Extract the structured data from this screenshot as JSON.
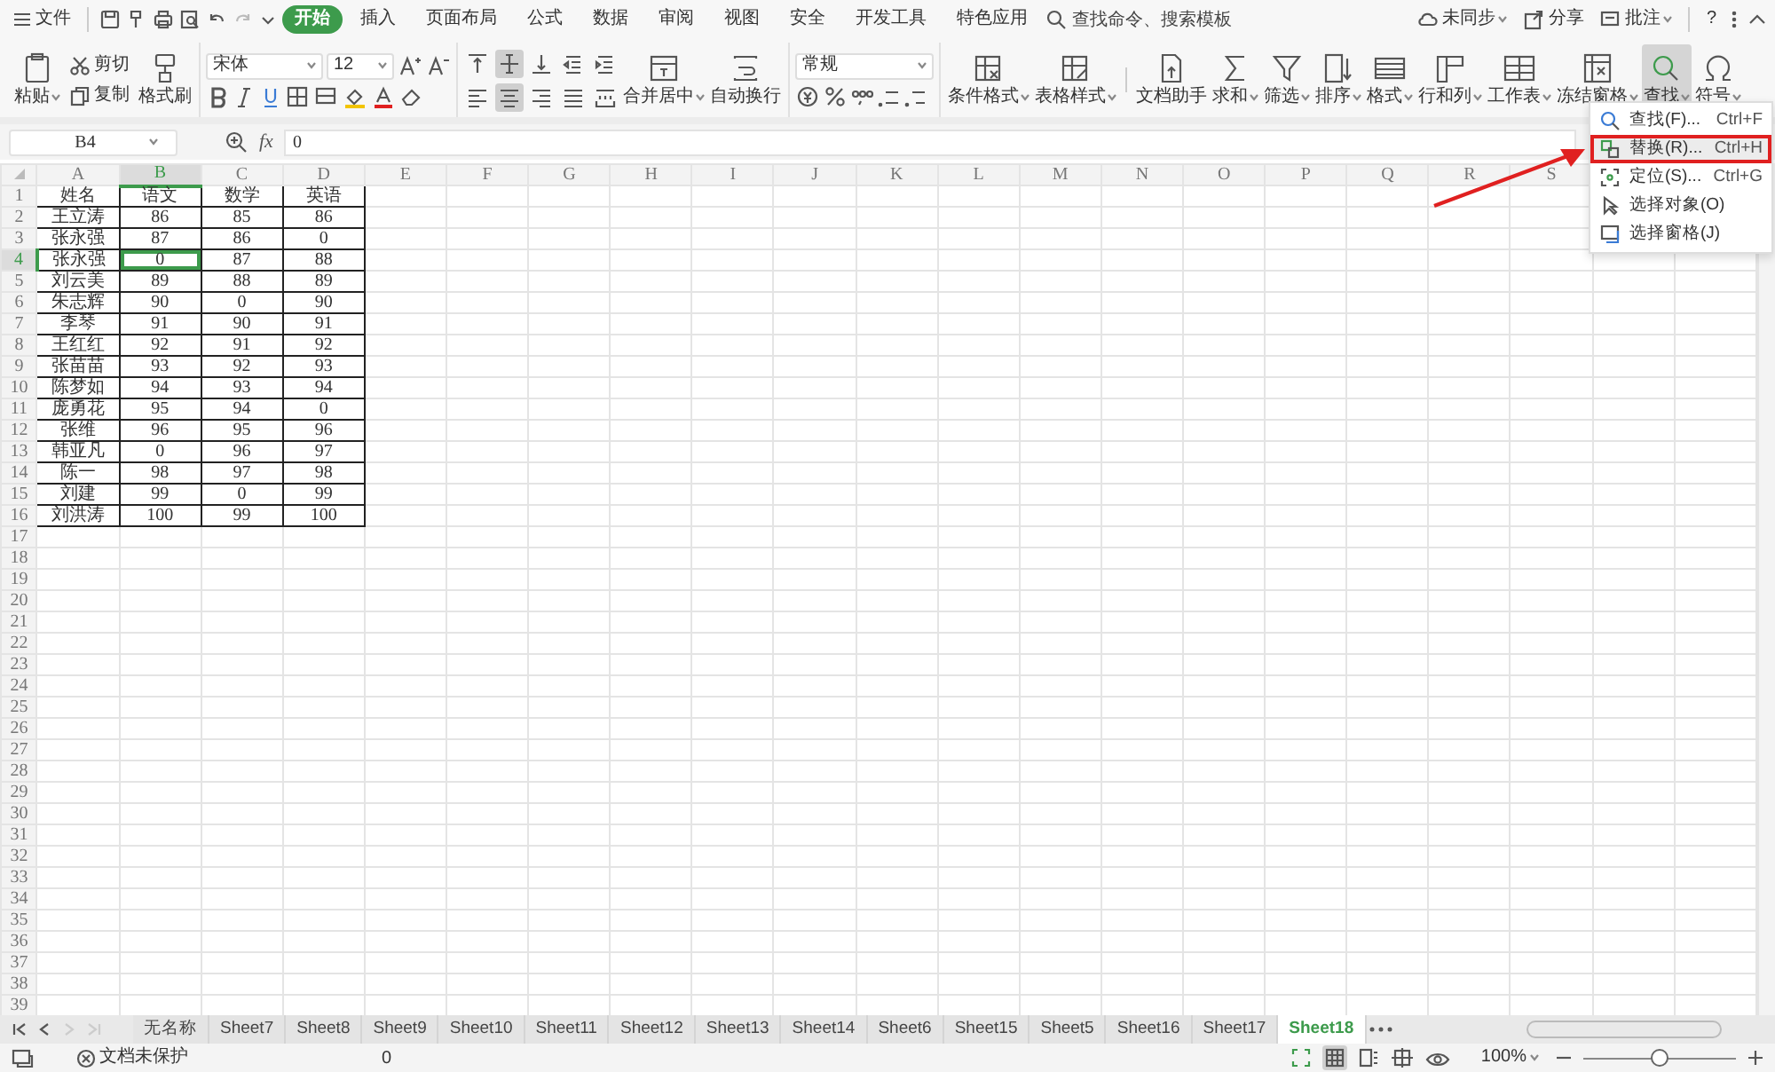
{
  "menu_bar": {
    "file": "文件",
    "tabs": [
      {
        "label": "开始",
        "selected": true
      },
      {
        "label": "插入",
        "selected": false
      },
      {
        "label": "页面布局",
        "selected": false
      },
      {
        "label": "公式",
        "selected": false
      },
      {
        "label": "数据",
        "selected": false
      },
      {
        "label": "审阅",
        "selected": false
      },
      {
        "label": "视图",
        "selected": false
      },
      {
        "label": "安全",
        "selected": false
      },
      {
        "label": "开发工具",
        "selected": false
      },
      {
        "label": "特色应用",
        "selected": false
      }
    ],
    "search": {
      "placeholder": "查找命令、搜索模板"
    },
    "actions": [
      {
        "label": "未同步",
        "dropdown": true
      },
      {
        "label": "分享",
        "dropdown": false
      },
      {
        "label": "批注",
        "dropdown": true
      }
    ],
    "help": "?"
  },
  "ribbon": {
    "clipboard": {
      "paste": "粘贴",
      "cut": "剪切",
      "copy": "复制",
      "format_painter": "格式刷"
    },
    "font": {
      "name": "宋体",
      "size": "12"
    },
    "alignment": {
      "buttons": [
        {
          "kind": "top",
          "selected": false
        },
        {
          "kind": "middle",
          "selected": true
        },
        {
          "kind": "bottom",
          "selected": false
        },
        {
          "kind": "outdent",
          "selected": false
        },
        {
          "kind": "indent",
          "selected": false
        },
        {
          "kind": "left",
          "selected": false
        },
        {
          "kind": "center",
          "selected": true
        },
        {
          "kind": "right",
          "selected": false
        },
        {
          "kind": "justify",
          "selected": false
        },
        {
          "kind": "distributed",
          "selected": false
        }
      ],
      "merge": "合并居中",
      "wrap": "自动换行"
    },
    "number": {
      "format": "常规"
    },
    "tools": [
      {
        "label": "条件格式",
        "dropdown": true,
        "selected": false
      },
      {
        "label": "表格样式",
        "dropdown": true,
        "selected": false
      },
      {
        "label": "文档助手",
        "dropdown": false,
        "selected": false
      },
      {
        "label": "求和",
        "dropdown": true,
        "selected": false
      },
      {
        "label": "筛选",
        "dropdown": true,
        "selected": false
      },
      {
        "label": "排序",
        "dropdown": true,
        "selected": false
      },
      {
        "label": "格式",
        "dropdown": true,
        "selected": false
      },
      {
        "label": "行和列",
        "dropdown": true,
        "selected": false
      },
      {
        "label": "工作表",
        "dropdown": true,
        "selected": false
      },
      {
        "label": "冻结窗格",
        "dropdown": true,
        "selected": false
      },
      {
        "label": "查找",
        "dropdown": true,
        "selected": true
      },
      {
        "label": "符号",
        "dropdown": true,
        "selected": false
      }
    ]
  },
  "formula_bar": {
    "name_box": "B4",
    "fx": "fx",
    "value": "0"
  },
  "sheet": {
    "columns": [
      {
        "label": "A",
        "selected": false
      },
      {
        "label": "B",
        "selected": true
      },
      {
        "label": "C",
        "selected": false
      },
      {
        "label": "D",
        "selected": false
      },
      {
        "label": "E",
        "selected": false
      },
      {
        "label": "F",
        "selected": false
      },
      {
        "label": "G",
        "selected": false
      },
      {
        "label": "H",
        "selected": false
      },
      {
        "label": "I",
        "selected": false
      },
      {
        "label": "J",
        "selected": false
      },
      {
        "label": "K",
        "selected": false
      },
      {
        "label": "L",
        "selected": false
      },
      {
        "label": "M",
        "selected": false
      },
      {
        "label": "N",
        "selected": false
      },
      {
        "label": "O",
        "selected": false
      },
      {
        "label": "P",
        "selected": false
      },
      {
        "label": "Q",
        "selected": false
      },
      {
        "label": "R",
        "selected": false
      },
      {
        "label": "S",
        "selected": false
      }
    ],
    "rows": [
      {
        "number": "1",
        "selected": false,
        "cells": [
          "姓名",
          "语文",
          "数学",
          "英语"
        ]
      },
      {
        "number": "2",
        "selected": false,
        "cells": [
          "王立涛",
          "86",
          "85",
          "86"
        ]
      },
      {
        "number": "3",
        "selected": false,
        "cells": [
          "张永强",
          "87",
          "86",
          "0"
        ]
      },
      {
        "number": "4",
        "selected": true,
        "cells": [
          "张永强",
          "0",
          "87",
          "88"
        ]
      },
      {
        "number": "5",
        "selected": false,
        "cells": [
          "刘云美",
          "89",
          "88",
          "89"
        ]
      },
      {
        "number": "6",
        "selected": false,
        "cells": [
          "朱志辉",
          "90",
          "0",
          "90"
        ]
      },
      {
        "number": "7",
        "selected": false,
        "cells": [
          "李琴",
          "91",
          "90",
          "91"
        ]
      },
      {
        "number": "8",
        "selected": false,
        "cells": [
          "王红红",
          "92",
          "91",
          "92"
        ]
      },
      {
        "number": "9",
        "selected": false,
        "cells": [
          "张苗苗",
          "93",
          "92",
          "93"
        ]
      },
      {
        "number": "10",
        "selected": false,
        "cells": [
          "陈梦如",
          "94",
          "93",
          "94"
        ]
      },
      {
        "number": "11",
        "selected": false,
        "cells": [
          "庞勇花",
          "95",
          "94",
          "0"
        ]
      },
      {
        "number": "12",
        "selected": false,
        "cells": [
          "张维",
          "96",
          "95",
          "96"
        ]
      },
      {
        "number": "13",
        "selected": false,
        "cells": [
          "韩亚凡",
          "0",
          "96",
          "97"
        ]
      },
      {
        "number": "14",
        "selected": false,
        "cells": [
          "陈一",
          "98",
          "97",
          "98"
        ]
      },
      {
        "number": "15",
        "selected": false,
        "cells": [
          "刘建",
          "99",
          "0",
          "99"
        ]
      },
      {
        "number": "16",
        "selected": false,
        "cells": [
          "刘洪涛",
          "100",
          "99",
          "100"
        ]
      },
      {
        "number": "17",
        "selected": false
      },
      {
        "number": "18",
        "selected": false
      },
      {
        "number": "19",
        "selected": false
      },
      {
        "number": "20",
        "selected": false
      },
      {
        "number": "21",
        "selected": false
      },
      {
        "number": "22",
        "selected": false
      },
      {
        "number": "23",
        "selected": false
      },
      {
        "number": "24",
        "selected": false
      },
      {
        "number": "25",
        "selected": false
      },
      {
        "number": "26",
        "selected": false
      },
      {
        "number": "27",
        "selected": false
      },
      {
        "number": "28",
        "selected": false
      },
      {
        "number": "29",
        "selected": false
      },
      {
        "number": "30",
        "selected": false
      },
      {
        "number": "31",
        "selected": false
      },
      {
        "number": "32",
        "selected": false
      },
      {
        "number": "33",
        "selected": false
      },
      {
        "number": "34",
        "selected": false
      },
      {
        "number": "35",
        "selected": false
      },
      {
        "number": "36",
        "selected": false
      },
      {
        "number": "37",
        "selected": false
      },
      {
        "number": "38",
        "selected": false
      },
      {
        "number": "39",
        "selected": false
      }
    ]
  },
  "find_menu": {
    "items": [
      {
        "label": "查找(F)...",
        "shortcut": "Ctrl+F",
        "highlighted": false
      },
      {
        "label": "替换(R)...",
        "shortcut": "Ctrl+H",
        "highlighted": true
      },
      {
        "label": "定位(S)...",
        "shortcut": "Ctrl+G",
        "highlighted": false
      },
      {
        "label": "选择对象(O)",
        "highlighted": false
      },
      {
        "label": "选择窗格(J)",
        "highlighted": false
      }
    ]
  },
  "sheet_tabs": [
    {
      "label": "无名称",
      "selected": false
    },
    {
      "label": "Sheet7",
      "selected": false
    },
    {
      "label": "Sheet8",
      "selected": false
    },
    {
      "label": "Sheet9",
      "selected": false
    },
    {
      "label": "Sheet10",
      "selected": false
    },
    {
      "label": "Sheet11",
      "selected": false
    },
    {
      "label": "Sheet12",
      "selected": false
    },
    {
      "label": "Sheet13",
      "selected": false
    },
    {
      "label": "Sheet14",
      "selected": false
    },
    {
      "label": "Sheet6",
      "selected": false
    },
    {
      "label": "Sheet15",
      "selected": false
    },
    {
      "label": "Sheet5",
      "selected": false
    },
    {
      "label": "Sheet16",
      "selected": false
    },
    {
      "label": "Sheet17",
      "selected": false
    },
    {
      "label": "Sheet18",
      "selected": true
    }
  ],
  "status_bar": {
    "protection": "文档未保护",
    "cell_value": "0",
    "zoom": "100%",
    "zoom_slider": {
      "level": 0.5
    }
  }
}
